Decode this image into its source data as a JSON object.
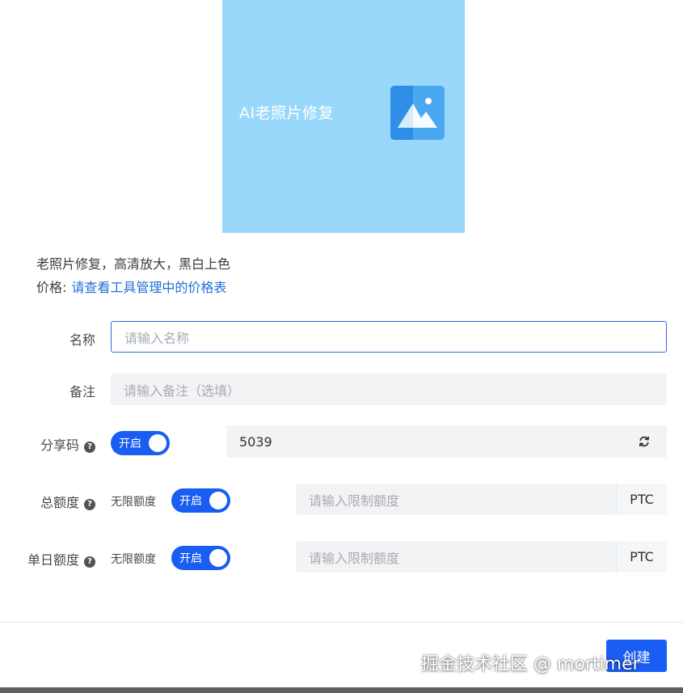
{
  "preview": {
    "title": "AI老照片修复",
    "icon": "image-icon",
    "background": "#9ad8fb"
  },
  "description": {
    "summary": "老照片修复，高清放大，黑白上色",
    "price_label": "价格:",
    "price_link": "请查看工具管理中的价格表"
  },
  "form": {
    "name": {
      "label": "名称",
      "placeholder": "请输入名称",
      "value": ""
    },
    "remark": {
      "label": "备注",
      "placeholder": "请输入备注（选填）",
      "value": ""
    },
    "share_code": {
      "label": "分享码",
      "toggle_label": "开启",
      "toggle_on": true,
      "value": "5039",
      "refresh_icon": "refresh-icon"
    },
    "total_quota": {
      "label": "总额度",
      "unlimited_label": "无限额度",
      "toggle_label": "开启",
      "toggle_on": true,
      "placeholder": "请输入限制额度",
      "unit": "PTC"
    },
    "daily_quota": {
      "label": "单日额度",
      "unlimited_label": "无限额度",
      "toggle_label": "开启",
      "toggle_on": true,
      "placeholder": "请输入限制额度",
      "unit": "PTC"
    }
  },
  "footer": {
    "create_label": "创建",
    "watermark": "掘金技术社区 @ mortimer"
  },
  "colors": {
    "primary": "#1a5df2",
    "link": "#1f6fd6",
    "input_bg": "#f2f3f5"
  }
}
